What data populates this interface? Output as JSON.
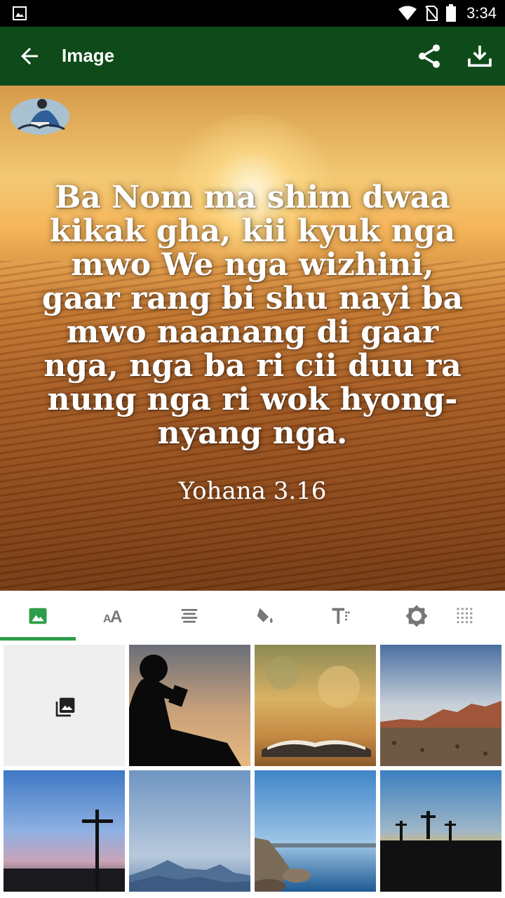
{
  "status_bar": {
    "time": "3:34"
  },
  "app_bar": {
    "title": "Image"
  },
  "verse": {
    "text": "Ba Nom ma shim dwaa kikak gha, kii kyuk nga mwo We nga wizhini, gaar rang bi shu nayi ba mwo naanang di gaar nga, nga ba ri cii duu ra nung nga ri wok hyong-nyang nga.",
    "reference": "Yohana 3.16"
  },
  "tabs": [
    {
      "icon": "image-icon",
      "active": true
    },
    {
      "icon": "font-size-icon",
      "active": false
    },
    {
      "icon": "align-icon",
      "active": false
    },
    {
      "icon": "fill-color-icon",
      "active": false
    },
    {
      "icon": "text-format-icon",
      "active": false
    },
    {
      "icon": "brightness-icon",
      "active": false
    },
    {
      "icon": "texture-icon",
      "active": false
    }
  ],
  "accent_color": "#2e9d49",
  "app_bar_color": "#0f4a1a",
  "backgrounds": [
    {
      "icon": "photo-library-icon"
    },
    {
      "name": "child-reading"
    },
    {
      "name": "open-bible"
    },
    {
      "name": "desert-mountains"
    },
    {
      "name": "cross-silhouette"
    },
    {
      "name": "misty-mountains"
    },
    {
      "name": "rocky-shore"
    },
    {
      "name": "three-crosses"
    }
  ]
}
